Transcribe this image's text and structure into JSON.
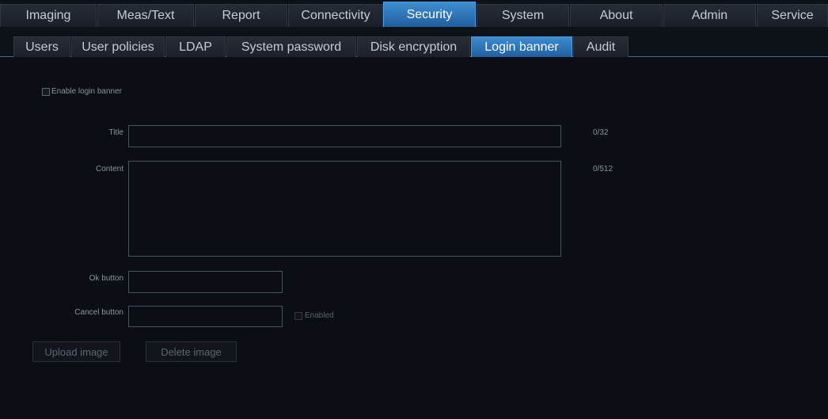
{
  "top_tabs": [
    {
      "label": "Imaging",
      "active": false
    },
    {
      "label": "Meas/Text",
      "active": false
    },
    {
      "label": "Report",
      "active": false
    },
    {
      "label": "Connectivity",
      "active": false
    },
    {
      "label": "Security",
      "active": true
    },
    {
      "label": "System",
      "active": false
    },
    {
      "label": "About",
      "active": false
    },
    {
      "label": "Admin",
      "active": false
    },
    {
      "label": "Service",
      "active": false
    }
  ],
  "sub_tabs": [
    {
      "label": "Users",
      "active": false
    },
    {
      "label": "User policies",
      "active": false
    },
    {
      "label": "LDAP",
      "active": false
    },
    {
      "label": "System password",
      "active": false
    },
    {
      "label": "Disk encryption",
      "active": false
    },
    {
      "label": "Login banner",
      "active": true
    },
    {
      "label": "Audit",
      "active": false
    }
  ],
  "form": {
    "enable_label": "Enable login banner",
    "enable_checked": false,
    "title_label": "Title",
    "title_value": "",
    "title_counter": "0/32",
    "content_label": "Content",
    "content_value": "",
    "content_counter": "0/512",
    "ok_label": "Ok button",
    "ok_value": "",
    "cancel_label": "Cancel button",
    "cancel_value": "",
    "enabled_label": "Enabled",
    "enabled_checked": false
  },
  "buttons": {
    "upload": "Upload image",
    "delete": "Delete image"
  },
  "colors": {
    "background": "#0b0f15",
    "tab_active": "#2f7ac0",
    "tab_inactive": "#22272f",
    "accent_line": "#3a6ea0"
  }
}
